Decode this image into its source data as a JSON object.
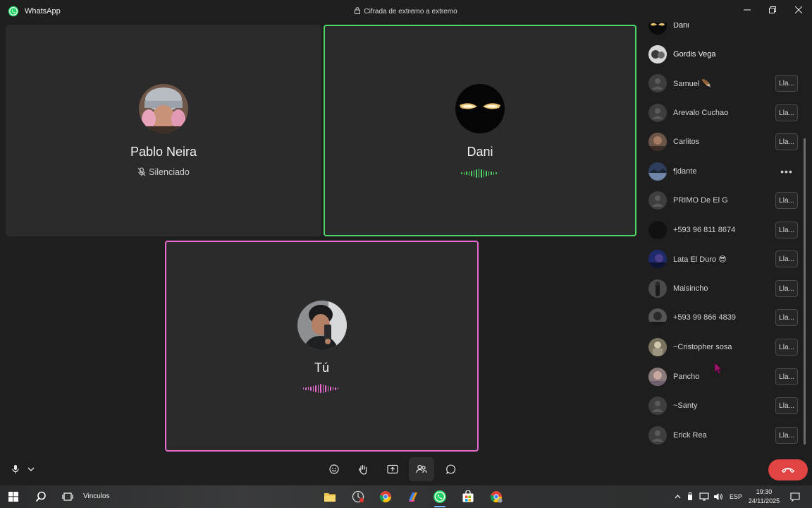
{
  "window": {
    "app_name": "WhatsApp",
    "encryption_label": "Cifrada de extremo a extremo"
  },
  "tiles": {
    "pablo": {
      "name": "Pablo Neira",
      "status": "Silenciado"
    },
    "dani": {
      "name": "Dani"
    },
    "tu": {
      "name": "Tú"
    }
  },
  "participants": {
    "call_label": "Lla...",
    "items": [
      {
        "name": "Dani",
        "action": ""
      },
      {
        "name": "Gordis Vega",
        "action": ""
      },
      {
        "name": "Samuel 🪶",
        "action": "call"
      },
      {
        "name": "Arevalo Cuchao",
        "action": "call"
      },
      {
        "name": "Carlitos",
        "action": "call"
      },
      {
        "name": "¶dante",
        "action": "more"
      },
      {
        "name": "PRIMO De El G",
        "action": "call"
      },
      {
        "name": "+593 96 811 8674",
        "action": "call"
      },
      {
        "name": "Lata El Duro 😎",
        "action": "call"
      },
      {
        "name": "Maisincho",
        "action": "call"
      },
      {
        "name": "+593 99 866 4839",
        "action": "call"
      },
      {
        "name": "~Cristopher sosa",
        "action": "call"
      },
      {
        "name": "Pancho",
        "action": "call"
      },
      {
        "name": "~Santy",
        "action": "call"
      },
      {
        "name": "Erick Rea",
        "action": "call"
      }
    ]
  },
  "taskbar": {
    "search_label": "Vinculos",
    "language": "ESP",
    "time": "19:30",
    "date": "24/11/2025"
  },
  "colors": {
    "speaking_green": "#4fd466",
    "self_pink": "#e56bd0",
    "hangup_red": "#e24343",
    "whatsapp_green": "#25d366"
  }
}
